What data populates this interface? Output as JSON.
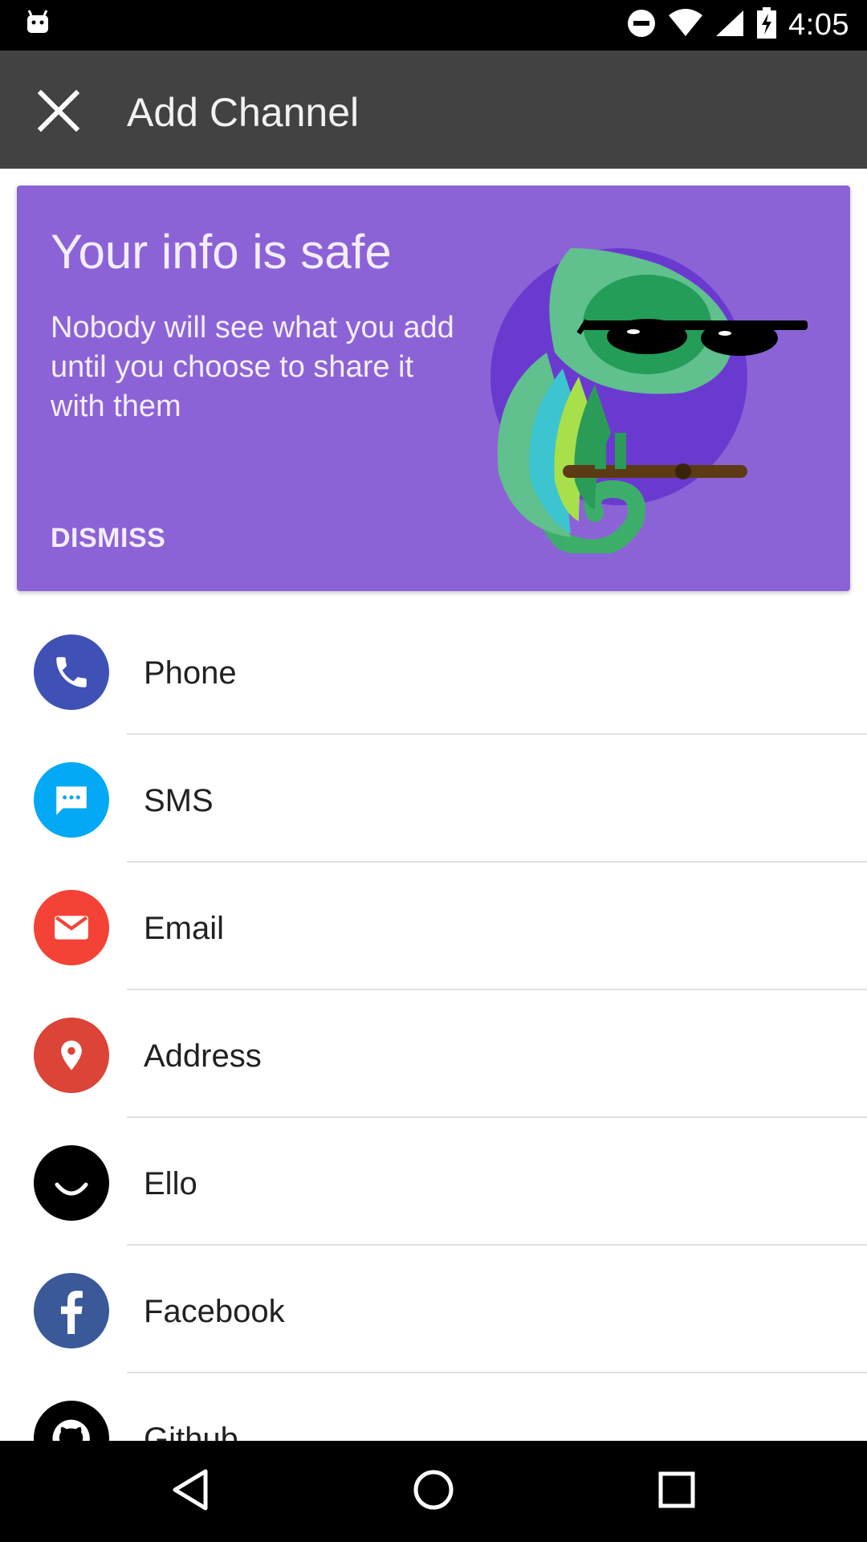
{
  "status_bar": {
    "time": "4:05",
    "icons": [
      "android-icon",
      "do-not-disturb-icon",
      "wifi-icon",
      "cell-signal-icon",
      "battery-charging-icon"
    ]
  },
  "app_bar": {
    "title": "Add Channel",
    "close_icon": "close-icon"
  },
  "info_card": {
    "title": "Your info is safe",
    "body": "Nobody will see what you add until you choose to share it with them",
    "dismiss_label": "DISMISS",
    "background_color": "#8c63d6",
    "illustration": "chameleon-with-sunglasses"
  },
  "channels": [
    {
      "label": "Phone",
      "icon": "phone-icon",
      "color": "#3f51b5"
    },
    {
      "label": "SMS",
      "icon": "sms-icon",
      "color": "#03a9f4"
    },
    {
      "label": "Email",
      "icon": "email-icon",
      "color": "#f44336"
    },
    {
      "label": "Address",
      "icon": "location-pin-icon",
      "color": "#db4437"
    },
    {
      "label": "Ello",
      "icon": "ello-icon",
      "color": "#000000"
    },
    {
      "label": "Facebook",
      "icon": "facebook-icon",
      "color": "#3b5998"
    },
    {
      "label": "Github",
      "icon": "github-icon",
      "color": "#000000"
    }
  ],
  "nav_bar": {
    "buttons": [
      "back-icon",
      "home-icon",
      "recents-icon"
    ]
  }
}
